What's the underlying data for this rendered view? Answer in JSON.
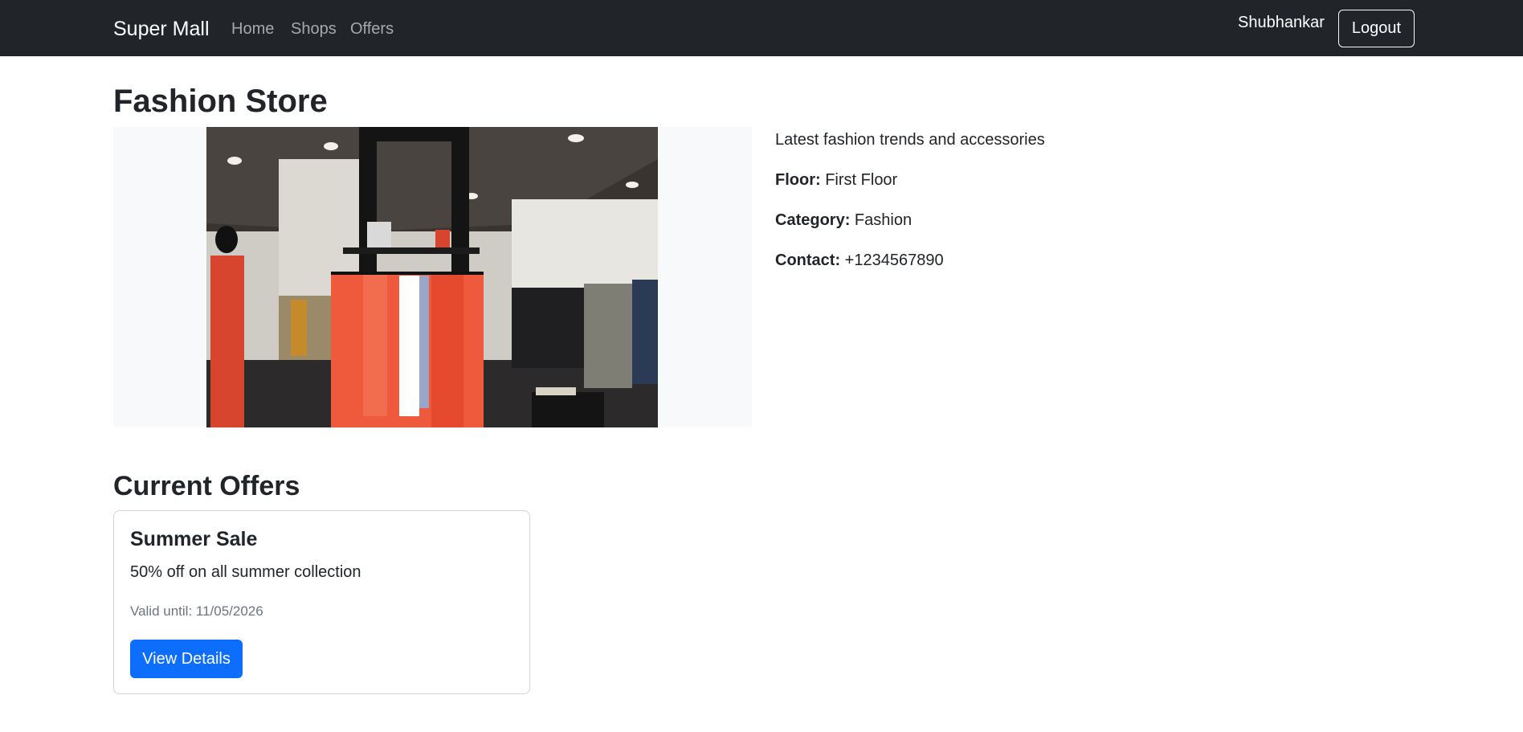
{
  "navbar": {
    "brand": "Super Mall",
    "links": [
      "Home",
      "Shops",
      "Offers"
    ],
    "username": "Shubhankar",
    "logout_label": "Logout"
  },
  "shop": {
    "name": "Fashion Store",
    "description": "Latest fashion trends and accessories",
    "floor_label": "Floor:",
    "floor": "First Floor",
    "category_label": "Category:",
    "category": "Fashion",
    "contact_label": "Contact:",
    "contact": "+1234567890"
  },
  "offers": {
    "heading": "Current Offers",
    "items": [
      {
        "title": "Summer Sale",
        "description": "50% off on all summer collection",
        "valid_until": "Valid until: 11/05/2026",
        "button_label": "View Details"
      }
    ]
  },
  "colors": {
    "navbar_bg": "#212529",
    "primary": "#0d6efd",
    "muted": "#6c757d"
  }
}
